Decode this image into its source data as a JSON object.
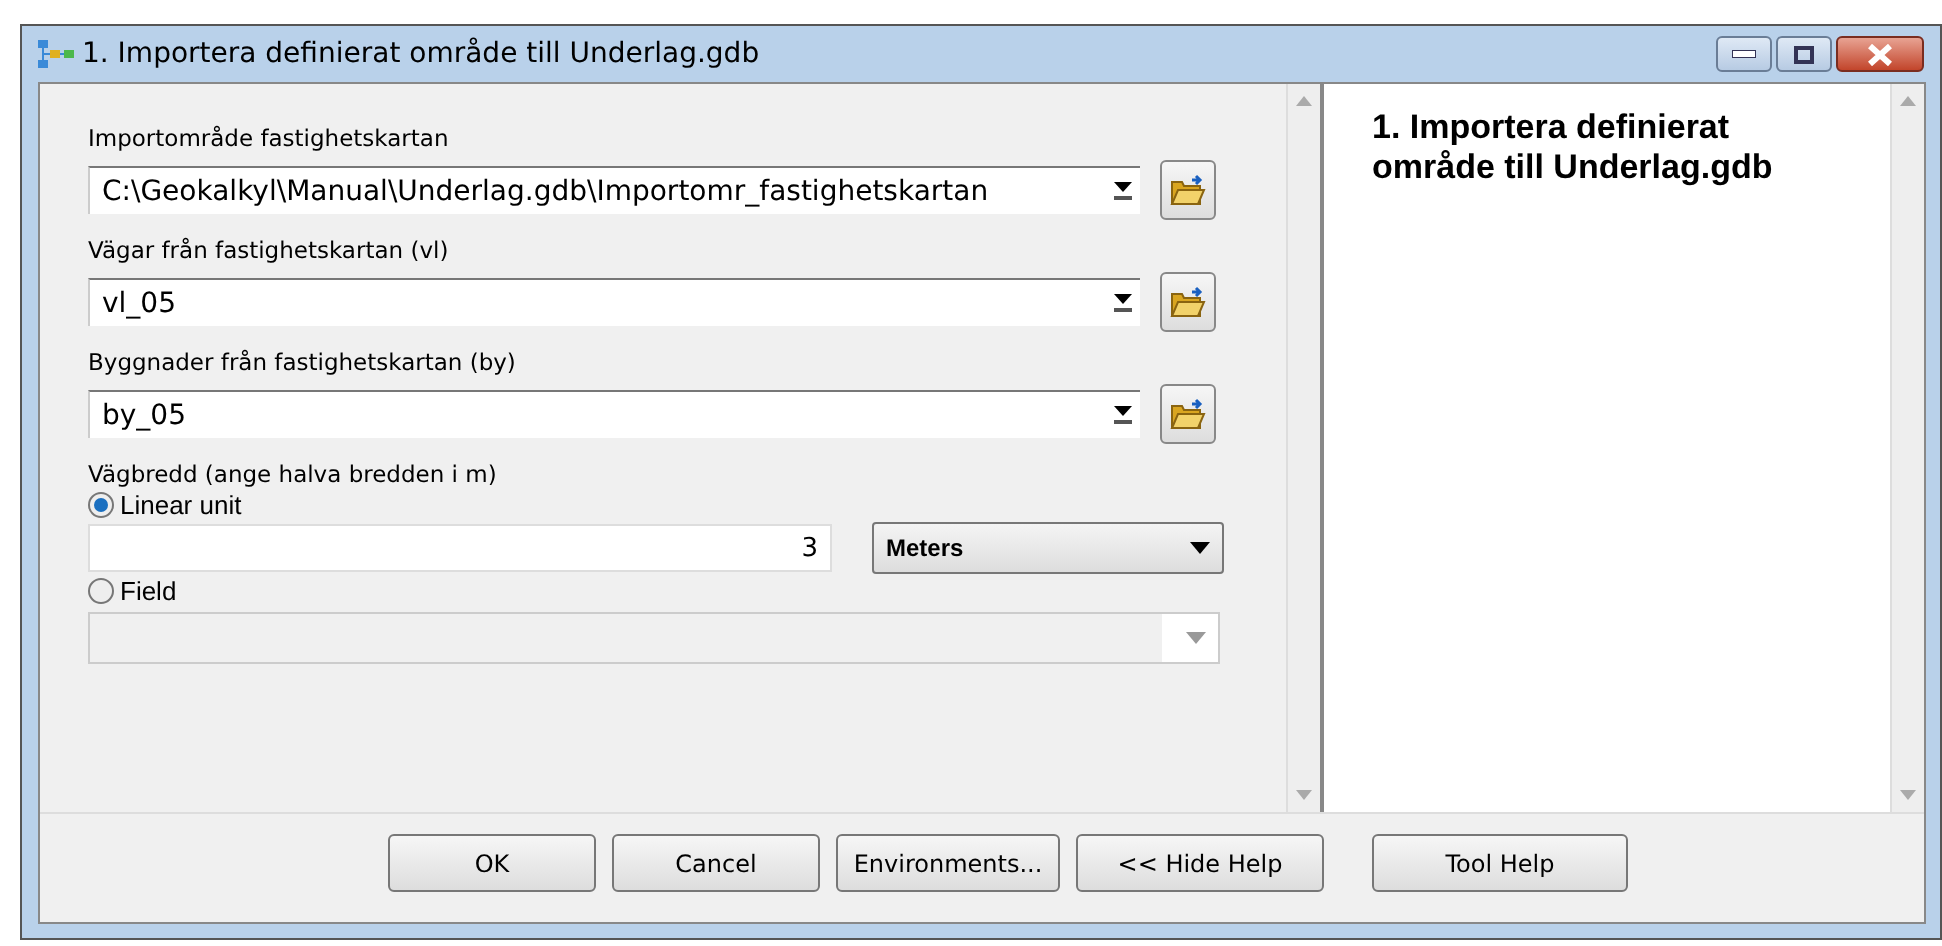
{
  "window": {
    "title": "1. Importera definierat område till Underlag.gdb"
  },
  "parameters": [
    {
      "kind": "dataset",
      "label": "Importområde fastighetskartan",
      "value": "C:\\Geokalkyl\\Manual\\Underlag.gdb\\Importomr_fastighetskartan"
    },
    {
      "kind": "dataset",
      "label": "Vägar från fastighetskartan (vl)",
      "value": "vl_05"
    },
    {
      "kind": "dataset",
      "label": "Byggnader från fastighetskartan (by)",
      "value": "by_05"
    },
    {
      "kind": "width",
      "label": "Vägbredd (ange halva bredden i m)",
      "options": [
        {
          "label": "Linear unit",
          "selected": true,
          "value": "3",
          "unit": "Meters"
        },
        {
          "label": "Field",
          "selected": false,
          "disabled": true
        }
      ]
    }
  ],
  "help": {
    "title": "1. Importera definierat område till Underlag.gdb"
  },
  "buttons": [
    "OK",
    "Cancel",
    "Environments...",
    "<< Hide Help",
    "Tool Help"
  ]
}
